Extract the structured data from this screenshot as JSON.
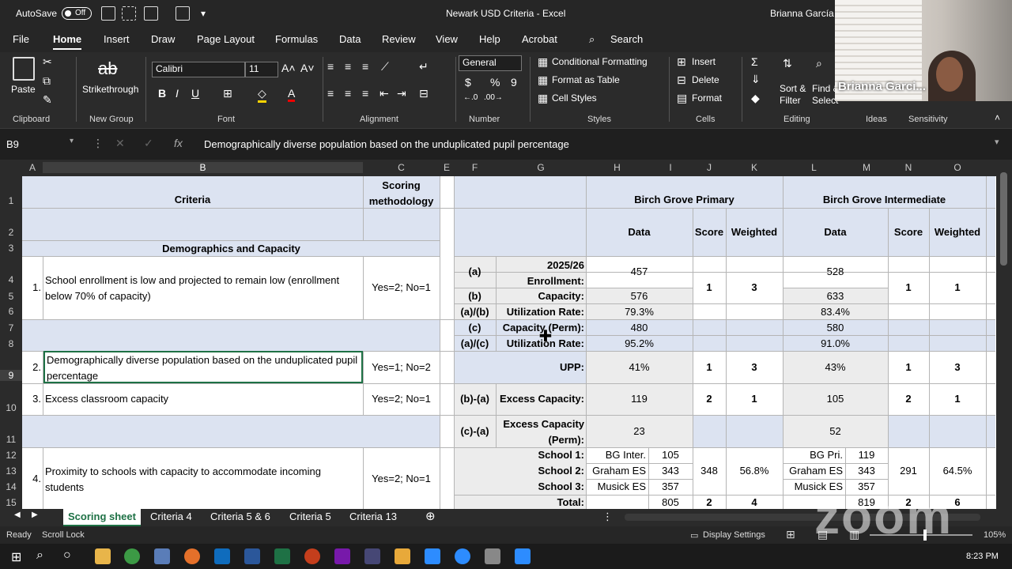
{
  "title_bar": {
    "autosave_label": "AutoSave",
    "autosave_state": "Off",
    "doc_title": "Newark USD Criteria  -  Excel",
    "user_name": "Brianna García"
  },
  "video": {
    "participant_name": "Brianna Garci..."
  },
  "menu_tabs": [
    "File",
    "Home",
    "Insert",
    "Draw",
    "Page Layout",
    "Formulas",
    "Data",
    "Review",
    "View",
    "Help",
    "Acrobat"
  ],
  "search_label": "Search",
  "ribbon": {
    "paste": "Paste",
    "strikethrough": "Strikethrough",
    "font_name": "Calibri",
    "font_size": "11",
    "number_format": "General",
    "conditional_formatting": "Conditional Formatting",
    "format_as_table": "Format as Table",
    "cell_styles": "Cell Styles",
    "insert": "Insert",
    "delete": "Delete",
    "format": "Format",
    "sort_filter": "Sort & Filter",
    "find_select": "Find & Select",
    "groups": {
      "clipboard": "Clipboard",
      "new_group": "New Group",
      "font": "Font",
      "alignment": "Alignment",
      "number": "Number",
      "styles": "Styles",
      "cells": "Cells",
      "editing": "Editing",
      "ideas": "Ideas",
      "sensitivity": "Sensitivity"
    }
  },
  "formula_bar": {
    "name_box": "B9",
    "fx": "fx",
    "value": "Demographically diverse population based on the unduplicated pupil percentage"
  },
  "columns": [
    "A",
    "B",
    "C",
    "E",
    "F",
    "G",
    "H",
    "I",
    "J",
    "K",
    "L",
    "M",
    "N",
    "O"
  ],
  "rows": [
    "1",
    "2",
    "3",
    "4",
    "5",
    "6",
    "7",
    "8",
    "9",
    "10",
    "11",
    "12",
    "13",
    "14",
    "15"
  ],
  "sheet": {
    "criteria_header": "Criteria",
    "scoring_header": "Scoring methodology",
    "school1": "Birch Grove Primary",
    "school2": "Birch Grove Intermediate",
    "data": "Data",
    "score": "Score",
    "weighted": "Weighted",
    "section": "Demographics and Capacity",
    "c1_num": "1.",
    "c1_text": "School enrollment is low and projected to remain low (enrollment below 70% of capacity)",
    "c1_score": "Yes=2; No=1",
    "c2_num": "2.",
    "c2_text": "Demographically diverse population based on the unduplicated pupil percentage",
    "c2_score": "Yes=1; No=2",
    "c3_num": "3.",
    "c3_text": "Excess classroom capacity",
    "c3_score": "Yes=2; No=1",
    "c4_num": "4.",
    "c4_text": "Proximity to schools with capacity to accommodate incoming students",
    "c4_score": "Yes=2; No=1",
    "f_a": "(a)",
    "f_b": "(b)",
    "f_ab": "(a)/(b)",
    "f_c": "(c)",
    "f_ac": "(a)/(c)",
    "f_ba": "(b)-(a)",
    "f_ca": "(c)-(a)",
    "g_enroll": "2025/26 Enrollment:",
    "g_capacity": "Capacity:",
    "g_util": "Utilization Rate:",
    "g_capperm": "Capacity (Perm):",
    "g_util2": "Utilization Rate:",
    "g_upp": "UPP:",
    "g_excess": "Excess Capacity:",
    "g_excessperm": "Excess Capacity (Perm):",
    "g_s1": "School 1:",
    "g_s2": "School 2:",
    "g_s3": "School 3:",
    "g_total": "Total:",
    "h": {
      "enroll": "457",
      "cap": "576",
      "util": "79.3%",
      "capperm": "480",
      "util2": "95.2%",
      "upp": "41%",
      "excess": "119",
      "excessperm": "23",
      "s1": "BG Inter.",
      "s1v": "105",
      "s2": "Graham ES",
      "s2v": "343",
      "s3": "Musick ES",
      "s3v": "357",
      "total": "805",
      "j1": "1",
      "k1": "3",
      "j2": "1",
      "k2": "3",
      "j3": "2",
      "k3": "1",
      "j4": "348",
      "k4": "56.8%",
      "jt": "2",
      "kt": "4"
    },
    "l": {
      "enroll": "528",
      "cap": "633",
      "util": "83.4%",
      "capperm": "580",
      "util2": "91.0%",
      "upp": "43%",
      "excess": "105",
      "excessperm": "52",
      "s1": "BG Pri.",
      "s1v": "119",
      "s2": "Graham ES",
      "s2v": "343",
      "s3": "Musick ES",
      "s3v": "357",
      "total": "819",
      "n1": "1",
      "o1": "1",
      "n2": "1",
      "o2": "3",
      "n3": "2",
      "o3": "1",
      "n4": "291",
      "o4": "64.5%",
      "nt": "2",
      "ot": "6"
    }
  },
  "sheet_tabs": [
    "Scoring sheet",
    "Criteria 4",
    "Criteria 5 & 6",
    "Criteria 5",
    "Criteria 13"
  ],
  "status": {
    "ready": "Ready",
    "scroll_lock": "Scroll Lock",
    "display_settings": "Display Settings",
    "zoom": "105%"
  },
  "taskbar": {
    "time": "8:23 PM"
  },
  "watermark": "zoom"
}
